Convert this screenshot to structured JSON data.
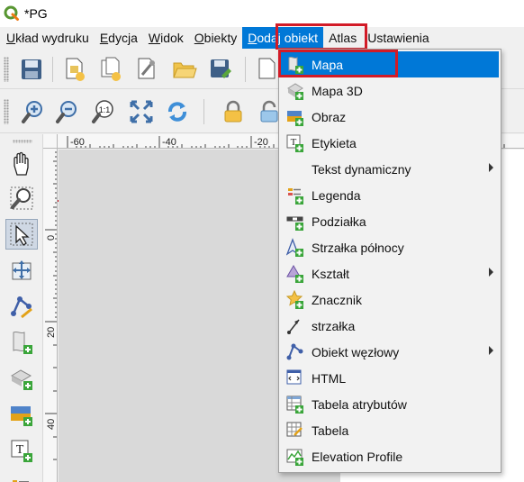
{
  "window": {
    "title": "*PG"
  },
  "menubar": {
    "items": [
      {
        "label": "Układ wydruku",
        "key": "U"
      },
      {
        "label": "Edycja",
        "key": "E"
      },
      {
        "label": "Widok",
        "key": "W"
      },
      {
        "label": "Obiekty",
        "key": "O"
      },
      {
        "label": "Dodaj obiekt",
        "key": "D"
      },
      {
        "label": "Atlas",
        "key": ""
      },
      {
        "label": "Ustawienia",
        "key": ""
      }
    ],
    "active_index": 4
  },
  "ruler": {
    "top_labels": [
      "-60",
      "-40",
      "-20"
    ],
    "left_labels": [
      "0",
      "20",
      "40"
    ]
  },
  "dropdown": {
    "items": [
      {
        "label": "Mapa",
        "icon": "add-map-icon",
        "submenu": false,
        "active": true
      },
      {
        "label": "Mapa 3D",
        "icon": "add-3d-map-icon",
        "submenu": false
      },
      {
        "label": "Obraz",
        "icon": "add-picture-icon",
        "submenu": false
      },
      {
        "label": "Etykieta",
        "icon": "add-label-icon",
        "submenu": false
      },
      {
        "label": "Tekst dynamiczny",
        "icon": "",
        "submenu": true
      },
      {
        "label": "Legenda",
        "icon": "add-legend-icon",
        "submenu": false
      },
      {
        "label": "Podziałka",
        "icon": "add-scalebar-icon",
        "submenu": false
      },
      {
        "label": "Strzałka północy",
        "icon": "add-north-arrow-icon",
        "submenu": false
      },
      {
        "label": "Kształt",
        "icon": "add-shape-icon",
        "submenu": true
      },
      {
        "label": "Znacznik",
        "icon": "add-marker-icon",
        "submenu": false
      },
      {
        "label": "strzałka",
        "icon": "add-arrow-icon",
        "submenu": false
      },
      {
        "label": "Obiekt węzłowy",
        "icon": "add-node-item-icon",
        "submenu": true
      },
      {
        "label": "HTML",
        "icon": "add-html-icon",
        "submenu": false
      },
      {
        "label": "Tabela atrybutów",
        "icon": "add-attribute-table-icon",
        "submenu": false
      },
      {
        "label": "Tabela",
        "icon": "add-table-icon",
        "submenu": false
      },
      {
        "label": "Elevation Profile",
        "icon": "add-elevation-profile-icon",
        "submenu": false
      }
    ]
  },
  "toolbar_top": {
    "icons": [
      "save-icon",
      "new-layout-icon",
      "duplicate-layout-icon",
      "layout-manager-icon",
      "open-template-icon",
      "save-template-icon",
      "page-setup-icon"
    ]
  },
  "toolbar_nav": {
    "icons": [
      "zoom-in-icon",
      "zoom-out-icon",
      "zoom-actual-icon",
      "zoom-full-icon",
      "refresh-icon",
      "lock-icon",
      "unlock-icon"
    ],
    "zoom_actual_text": "1:1"
  },
  "left_tools": {
    "icons": [
      "pan-icon",
      "zoom-tool-icon",
      "select-icon",
      "move-content-icon",
      "edit-nodes-icon",
      "add-map-tool-icon",
      "add-3d-map-tool-icon",
      "add-picture-tool-icon",
      "add-label-tool-icon",
      "add-legend-tool-icon"
    ],
    "selected_index": 2,
    "label_glyph": "T"
  },
  "colors": {
    "accent": "#0078d7",
    "highlight": "#d21b27",
    "canvas": "#d9d9d9",
    "menu_bg": "#f2f2f2",
    "qgis_green": "#589632"
  }
}
